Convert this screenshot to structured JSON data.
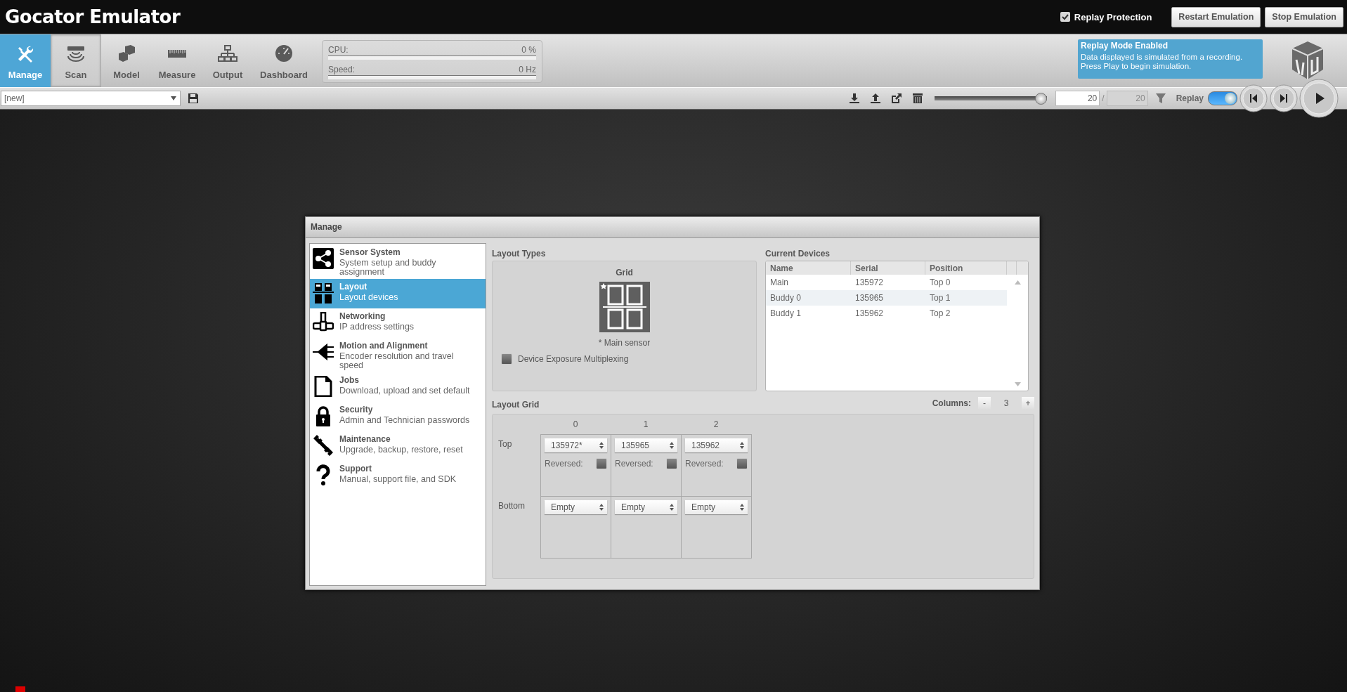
{
  "title": "Gocator Emulator",
  "header": {
    "replay_protection": {
      "label": "Replay Protection",
      "checked": true
    },
    "buttons": [
      "Restart Emulation",
      "Stop Emulation"
    ]
  },
  "nav_tabs": [
    {
      "label": "Manage",
      "selected": true,
      "highlighted": false
    },
    {
      "label": "Scan",
      "selected": false,
      "highlighted": true
    },
    {
      "label": "Model",
      "selected": false,
      "highlighted": false
    },
    {
      "label": "Measure",
      "selected": false,
      "highlighted": false
    },
    {
      "label": "Output",
      "selected": false,
      "highlighted": false
    },
    {
      "label": "Dashboard",
      "selected": false,
      "highlighted": false
    }
  ],
  "status": [
    {
      "label": "CPU:",
      "value": "0 %",
      "level": 0
    },
    {
      "label": "Speed:",
      "value": "0 Hz",
      "level": 0
    }
  ],
  "replay_notice": {
    "title": "Replay Mode Enabled",
    "lines": [
      "Data displayed is simulated from a recording.",
      "Press Play to begin simulation."
    ]
  },
  "job_bar": {
    "job": "[new]"
  },
  "replay_bar": {
    "level": 1,
    "frame": "20",
    "separator": "/",
    "total": "20",
    "label": "Replay",
    "on": true
  },
  "dialog": {
    "title": "Manage",
    "sidebar": [
      {
        "title": "Sensor System",
        "description": "System setup and buddy assignment",
        "selected": false
      },
      {
        "title": "Layout",
        "description": "Layout devices",
        "selected": true
      },
      {
        "title": "Networking",
        "description": "IP address settings",
        "selected": false
      },
      {
        "title": "Motion and Alignment",
        "description": "Encoder resolution and travel speed",
        "selected": false
      },
      {
        "title": "Jobs",
        "description": "Download, upload and set default",
        "selected": false
      },
      {
        "title": "Security",
        "description": "Admin and Technician passwords",
        "selected": false
      },
      {
        "title": "Maintenance",
        "description": "Upgrade, backup, restore, reset",
        "selected": false
      },
      {
        "title": "Support",
        "description": "Manual, support file, and SDK",
        "selected": false
      }
    ],
    "layout_types": {
      "heading": "Layout Types",
      "type_label": "Grid",
      "note": "* Main sensor",
      "multiplexing": {
        "label": "Device Exposure Multiplexing",
        "checked": false
      }
    },
    "current_devices": {
      "heading": "Current Devices",
      "columns": [
        "Name",
        "Serial",
        "Position"
      ],
      "rows": [
        [
          "Main",
          "135972",
          "Top 0"
        ],
        [
          "Buddy 0",
          "135965",
          "Top 1"
        ],
        [
          "Buddy 1",
          "135962",
          "Top 2"
        ]
      ]
    },
    "layout_grid": {
      "heading": "Layout Grid",
      "columns_label": "Columns:",
      "decrement": "-",
      "columns_count": "3",
      "increment": "+",
      "column_headers": [
        "0",
        "1",
        "2"
      ],
      "rows": [
        {
          "label": "Top",
          "cells": [
            {
              "value": "135972*",
              "reversed_label": "Reversed:",
              "reversed": false
            },
            {
              "value": "135965",
              "reversed_label": "Reversed:",
              "reversed": false
            },
            {
              "value": "135962",
              "reversed_label": "Reversed:",
              "reversed": false
            }
          ]
        },
        {
          "label": "Bottom",
          "cells": [
            {
              "value": "Empty"
            },
            {
              "value": "Empty"
            },
            {
              "value": "Empty"
            }
          ]
        }
      ]
    }
  }
}
